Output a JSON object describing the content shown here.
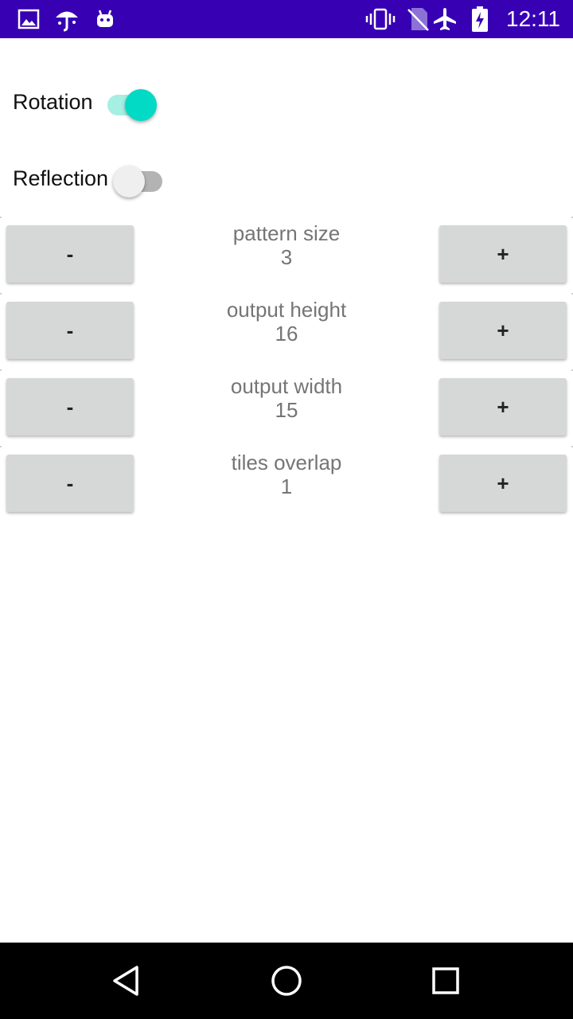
{
  "status_bar": {
    "time": "12:11",
    "left_icons": [
      "image-icon",
      "umbrella-icon",
      "android-icon"
    ],
    "right_icons": [
      "vibrate-icon",
      "no-sim-icon",
      "airplane-icon",
      "battery-charging-icon"
    ],
    "background": "#3700b3"
  },
  "settings": {
    "rotation": {
      "label": "Rotation",
      "enabled": true
    },
    "reflection": {
      "label": "Reflection",
      "enabled": false
    }
  },
  "steppers": [
    {
      "label": "pattern size",
      "value": "3",
      "minus": "-",
      "plus": "+"
    },
    {
      "label": "output height",
      "value": "16",
      "minus": "-",
      "plus": "+"
    },
    {
      "label": "output width",
      "value": "15",
      "minus": "-",
      "plus": "+"
    },
    {
      "label": "tiles overlap",
      "value": "1",
      "minus": "-",
      "plus": "+"
    }
  ],
  "nav_bar": {
    "icons": [
      "back-icon",
      "home-icon",
      "recents-icon"
    ]
  },
  "colors": {
    "accent": "#03dac5",
    "accent_track": "#a5efe3",
    "button_bg": "#d6d7d7",
    "label_text": "#757575"
  }
}
